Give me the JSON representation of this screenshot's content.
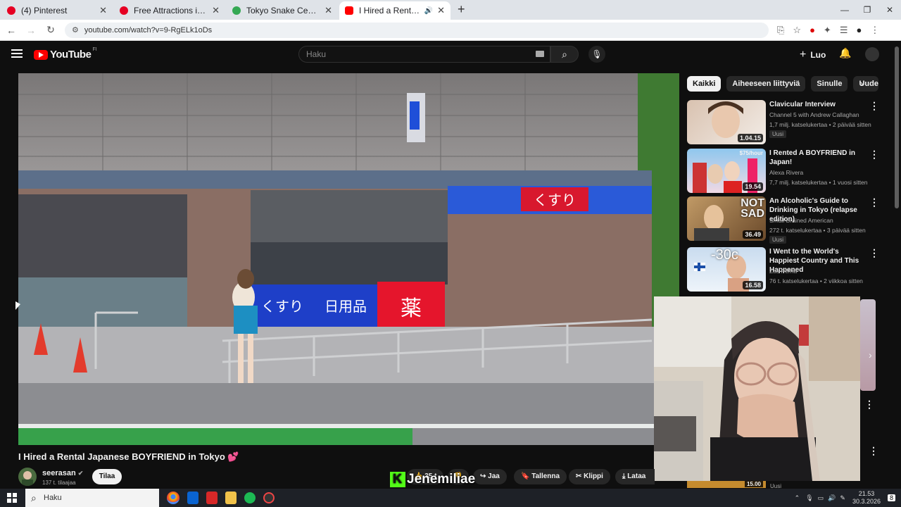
{
  "browser": {
    "tabs": [
      {
        "title": "(4) Pinterest",
        "icon": "pinterest-icon",
        "color": "#e60023"
      },
      {
        "title": "Free Attractions in Tokyo Itiner",
        "icon": "pinterest-icon",
        "color": "#e60023"
      },
      {
        "title": "Tokyo Snake Center ~Cafe & Sh",
        "icon": "maps-pin-icon",
        "color": "#34a853"
      },
      {
        "title": "I Hired a Rental Japanese B",
        "icon": "youtube-icon",
        "color": "#ff0000",
        "active": true
      }
    ],
    "url": "youtube.com/watch?v=9-RgELk1oDs"
  },
  "youtube": {
    "logo_text": "YouTube",
    "country_code": "FI",
    "search_placeholder": "Haku",
    "create_label": "Luo"
  },
  "video": {
    "title": "I Hired a Rental Japanese BOYFRIEND in Tokyo 💕",
    "channel": "seerasan",
    "subscribers": "137 t. tilaajaa",
    "subscribe_label": "Tilaa",
    "like_count": "35 t",
    "actions": {
      "share": "Jaa",
      "save": "Tallenna",
      "clip": "Klippi",
      "download": "Lataa"
    },
    "scene_signs": {
      "kusuri": "くすり",
      "nichiyouhin": "日用品",
      "yaku": "薬",
      "kusuri_top": "くすり"
    }
  },
  "filter_chips": [
    "Kaikki",
    "Aiheeseen liittyviä",
    "Sinulle",
    "Uudet l"
  ],
  "recommendations": [
    {
      "title": "Clavicular Interview",
      "channel": "Channel 5 with Andrew Callaghan",
      "meta": "1,7 milj. katselukertaa • 2 päivää sitten",
      "duration": "1.04.15",
      "badge": "Uusi",
      "thumb_text": ""
    },
    {
      "title": "I Rented A BOYFRIEND in Japan!",
      "channel": "Alexa Rivera",
      "meta": "7,7 milj. katselukertaa • 1 vuosi sitten",
      "duration": "19.54",
      "badge": "",
      "thumb_text": "$75/hour"
    },
    {
      "title": "An Alcoholic's Guide to Drinking in Tokyo (relapse edition)",
      "channel": "Small Brained American",
      "meta": "272 t. katselukertaa • 3 päivää sitten",
      "duration": "36.49",
      "badge": "Uusi",
      "thumb_text": "NOT SAD"
    },
    {
      "title": "I Went to the World's Happiest Country and This Happened",
      "channel": "Zac Perna",
      "meta": "76 t. katselukertaa • 2 viikkoa sitten",
      "duration": "16.58",
      "badge": "",
      "thumb_text": "-30c"
    }
  ],
  "partial_recommendation": {
    "duration": "15.00",
    "badge": "Uusi"
  },
  "stream_overlay": {
    "name": "Jenemiliae"
  },
  "taskbar": {
    "search_placeholder": "Haku",
    "time": "21.53",
    "date": "30.3.2026",
    "notifications": "8"
  }
}
